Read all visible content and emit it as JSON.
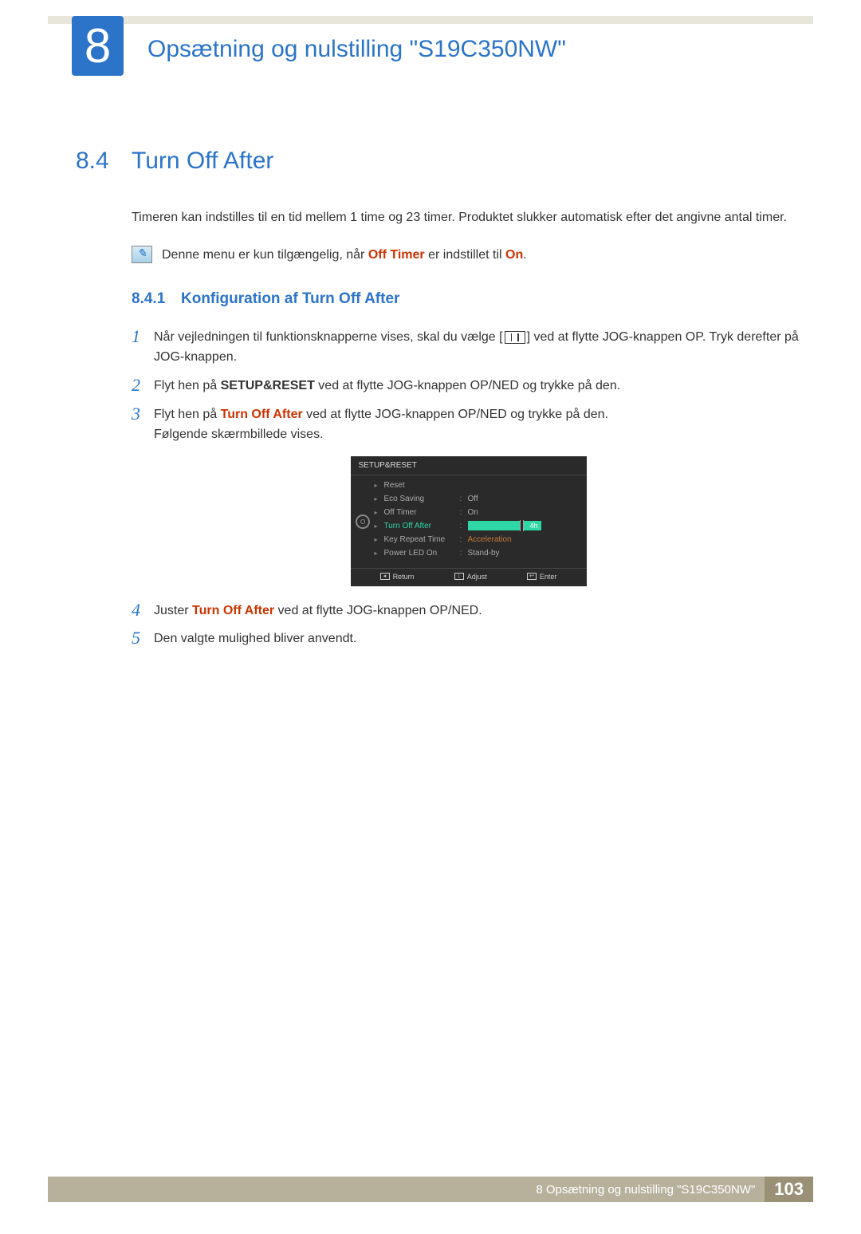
{
  "chapter": {
    "number": "8",
    "title": "Opsætning og nulstilling \"S19C350NW\""
  },
  "section": {
    "number": "8.4",
    "title": "Turn Off After",
    "intro": "Timeren kan indstilles til en tid mellem 1 time og 23 timer. Produktet slukker automatisk efter det angivne antal timer."
  },
  "note": {
    "prefix": "Denne menu er kun tilgængelig, når ",
    "bold1": "Off Timer",
    "mid": " er indstillet til ",
    "bold2": "On",
    "suffix": "."
  },
  "subsection": {
    "number": "8.4.1",
    "title": "Konfiguration af Turn Off After"
  },
  "steps": {
    "s1": {
      "num": "1",
      "a": "Når vejledningen til funktionsknapperne vises, skal du vælge [",
      "b": "] ved at flytte JOG-knappen OP. Tryk derefter på JOG-knappen."
    },
    "s2": {
      "num": "2",
      "a": "Flyt hen på ",
      "bold": "SETUP&RESET",
      "b": " ved at flytte JOG-knappen OP/NED og trykke på den."
    },
    "s3": {
      "num": "3",
      "a": "Flyt hen på ",
      "bold": "Turn Off After",
      "b": " ved at flytte JOG-knappen OP/NED og trykke på den.",
      "c": "Følgende skærmbillede vises."
    },
    "s4": {
      "num": "4",
      "a": "Juster ",
      "bold": "Turn Off After",
      "b": " ved at flytte JOG-knappen OP/NED."
    },
    "s5": {
      "num": "5",
      "a": "Den valgte mulighed bliver anvendt."
    }
  },
  "osd": {
    "title": "SETUP&RESET",
    "rows": [
      {
        "label": "Reset",
        "value": ""
      },
      {
        "label": "Eco Saving",
        "value": "Off"
      },
      {
        "label": "Off Timer",
        "value": "On"
      },
      {
        "label": "Turn Off After",
        "value": "4h",
        "active": true,
        "slider": true
      },
      {
        "label": "Key Repeat Time",
        "value": "Acceleration",
        "accel": true
      },
      {
        "label": "Power LED On",
        "value": "Stand-by"
      }
    ],
    "footer": {
      "return": "Return",
      "adjust": "Adjust",
      "enter": "Enter"
    }
  },
  "footer": {
    "text": "8 Opsætning og nulstilling \"S19C350NW\"",
    "page": "103"
  }
}
